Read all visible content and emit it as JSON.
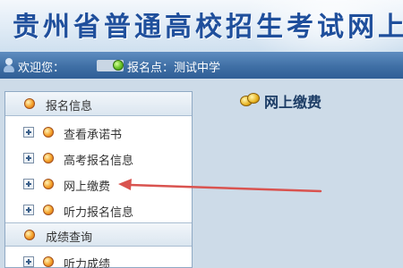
{
  "banner": {
    "title": "贵州省普通高校招生考试网上报名"
  },
  "welcome_bar": {
    "welcome_label": "欢迎您：",
    "site_label": "报名点：测试中学"
  },
  "sidebar": {
    "sections": [
      {
        "title": "报名信息",
        "items": [
          "查看承诺书",
          "高考报名信息",
          "网上缴费",
          "听力报名信息"
        ]
      },
      {
        "title": "成绩查询",
        "items": [
          "听力成绩"
        ]
      }
    ]
  },
  "content": {
    "title": "网上缴费"
  },
  "colors": {
    "banner_title": "#1f4f9c",
    "welcome_bar": "#3f6fa5",
    "main_bg": "#cddbe8",
    "annotation_arrow": "#d9534f"
  },
  "icons": {
    "user": "user-icon",
    "site": "green-dot-icon",
    "section": "orange-dot-icon",
    "expand": "plus-box-icon",
    "payment": "coins-icon"
  }
}
